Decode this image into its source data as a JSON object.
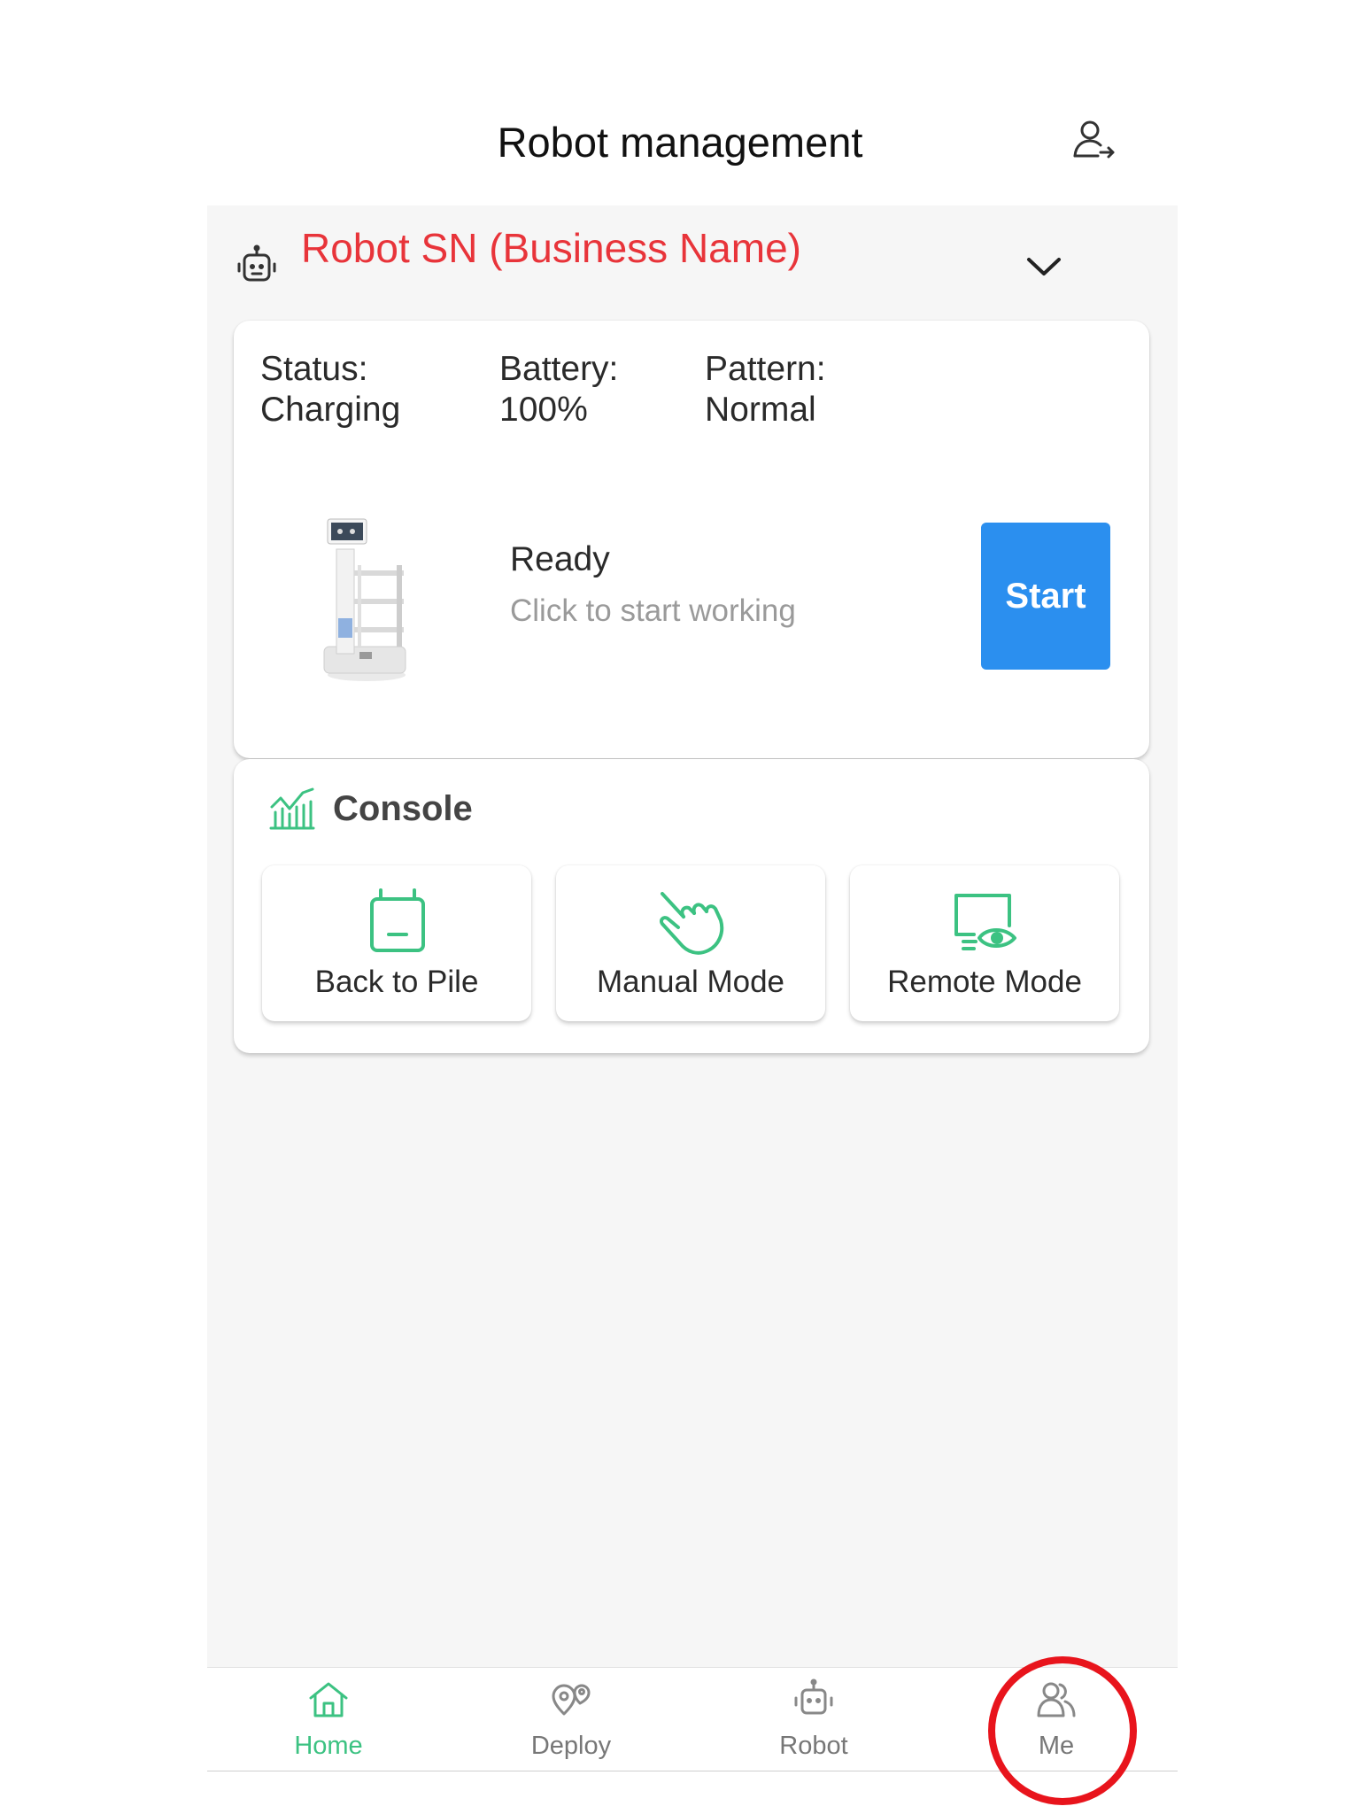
{
  "header": {
    "title": "Robot management",
    "logout_icon": "user-logout-icon"
  },
  "robot_selector": {
    "name": "Robot SN (Business Name)",
    "icon": "robot-icon",
    "dropdown_icon": "chevron-down-icon"
  },
  "status_card": {
    "status_label": "Status:",
    "status_value": "Charging",
    "battery_label": "Battery:",
    "battery_value": "100%",
    "pattern_label": "Pattern:",
    "pattern_value": "Normal",
    "ready_title": "Ready",
    "ready_subtitle": "Click to start working",
    "start_label": "Start"
  },
  "console": {
    "title": "Console",
    "buttons": [
      {
        "label": "Back to Pile",
        "icon": "charging-pile-icon"
      },
      {
        "label": "Manual Mode",
        "icon": "hand-pointer-icon"
      },
      {
        "label": "Remote Mode",
        "icon": "remote-monitor-icon"
      }
    ]
  },
  "bottom_nav": {
    "items": [
      {
        "label": "Home",
        "icon": "home-icon",
        "active": true
      },
      {
        "label": "Deploy",
        "icon": "map-pin-icon",
        "active": false
      },
      {
        "label": "Robot",
        "icon": "robot-icon",
        "active": false
      },
      {
        "label": "Me",
        "icon": "users-icon",
        "active": false
      }
    ]
  },
  "colors": {
    "accent_green": "#3cc282",
    "primary_blue": "#2b8fef",
    "robot_name_red": "#e8343a",
    "annotation_red": "#e8141c"
  }
}
